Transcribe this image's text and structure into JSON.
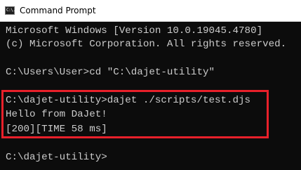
{
  "window": {
    "title": "Command Prompt",
    "icon": "cmd-icon",
    "icon_glyph": "C:\\."
  },
  "console": {
    "lines": [
      "Microsoft Windows [Version 10.0.19045.4780]",
      "(c) Microsoft Corporation. All rights reserved.",
      "",
      "C:\\Users\\User>cd \"C:\\dajet-utility\"",
      "",
      "C:\\dajet-utility>dajet ./scripts/test.djs",
      "Hello from DaJet!",
      "[200][TIME 58 ms]",
      "",
      "C:\\dajet-utility>"
    ],
    "text_color": "#cccccc",
    "background": "#0c0c0c",
    "highlight_color": "#e8202a"
  }
}
